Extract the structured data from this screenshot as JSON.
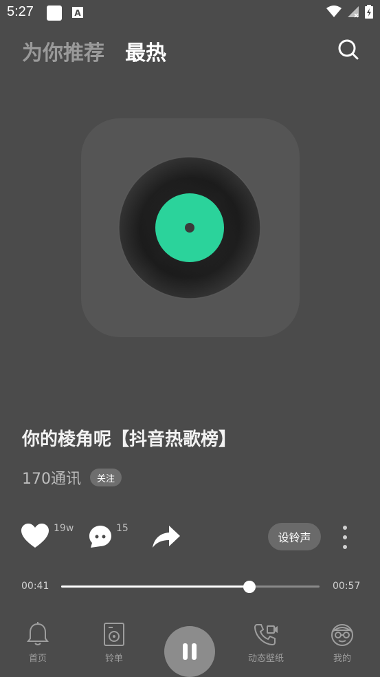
{
  "status_bar": {
    "time": "5:27"
  },
  "tabs": [
    {
      "label": "为你推荐",
      "active": false
    },
    {
      "label": "最热",
      "active": true
    }
  ],
  "song": {
    "title": "你的棱角呢【抖音热歌榜】",
    "artist": "170通讯",
    "follow_label": "关注",
    "cover_accent": "#2bd39b"
  },
  "actions": {
    "likes": "19w",
    "comments": "15",
    "set_ringtone_label": "设铃声"
  },
  "playback": {
    "current_time": "00:41",
    "total_time": "00:57",
    "progress": 0.729,
    "state": "playing"
  },
  "nav": [
    {
      "label": "首页",
      "icon": "bell-icon"
    },
    {
      "label": "铃单",
      "icon": "speaker-icon"
    },
    {
      "label": "动态壁纸",
      "icon": "phone-video-icon"
    },
    {
      "label": "我的",
      "icon": "avatar-icon"
    }
  ]
}
